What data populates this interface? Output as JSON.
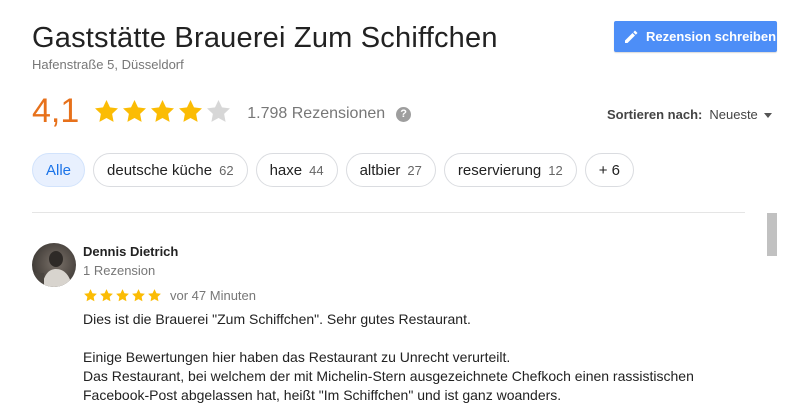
{
  "place": {
    "title": "Gaststätte Brauerei Zum Schiffchen",
    "address": "Hafenstraße 5, Düsseldorf"
  },
  "write_review_button": {
    "label": "Rezension schreiben",
    "icon": "pencil-icon",
    "color": "#4d8ef7"
  },
  "summary": {
    "rating": "4,1",
    "rating_value": 4.1,
    "stars_max": 5,
    "review_count": "1.798 Rezensionen",
    "help_icon": "?",
    "star_color": "#fbbc04",
    "rating_color": "#e7711b"
  },
  "sort": {
    "label": "Sortieren nach:",
    "value": "Neueste"
  },
  "chips": [
    {
      "label": "Alle",
      "count": "",
      "active": true
    },
    {
      "label": "deutsche küche",
      "count": "62",
      "active": false
    },
    {
      "label": "haxe",
      "count": "44",
      "active": false
    },
    {
      "label": "altbier",
      "count": "27",
      "active": false
    },
    {
      "label": "reservierung",
      "count": "12",
      "active": false
    },
    {
      "label": "+ 6",
      "count": "",
      "active": false
    }
  ],
  "reviews": [
    {
      "name": "Dennis Dietrich",
      "meta": "1 Rezension",
      "stars": 5,
      "time": "vor 47 Minuten",
      "paragraphs": [
        "Dies ist die Brauerei \"Zum Schiffchen\". Sehr gutes Restaurant.",
        "Einige Bewertungen hier haben das Restaurant zu Unrecht verurteilt.\nDas Restaurant, bei welchem der mit Michelin-Stern ausgezeichnete Chefkoch einen rassistischen Facebook-Post abgelassen hat, heißt \"Im Schiffchen\" und ist ganz woanders."
      ]
    }
  ]
}
